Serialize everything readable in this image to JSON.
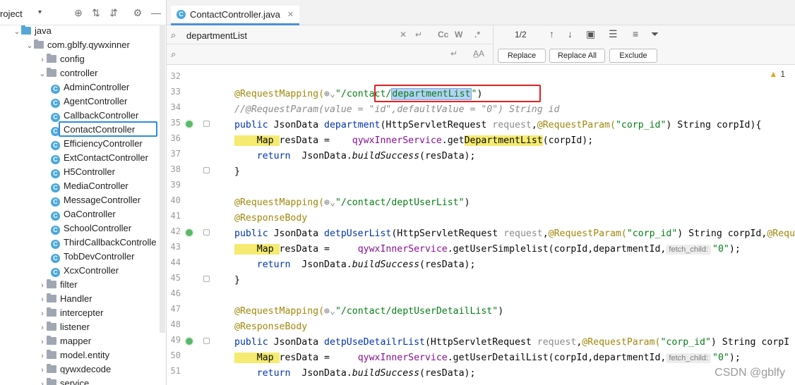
{
  "project_panel": {
    "title": "roject",
    "tree": [
      {
        "label": "java",
        "indent": 1,
        "type": "folder-blue",
        "expanded": true
      },
      {
        "label": "com.gblfy.qywxinner",
        "indent": 2,
        "type": "package",
        "expanded": true
      },
      {
        "label": "config",
        "indent": 3,
        "type": "package",
        "expanded": false
      },
      {
        "label": "controller",
        "indent": 3,
        "type": "package",
        "expanded": true
      },
      {
        "label": "AdminController",
        "indent": 4,
        "type": "class"
      },
      {
        "label": "AgentController",
        "indent": 4,
        "type": "class"
      },
      {
        "label": "CallbackController",
        "indent": 4,
        "type": "class"
      },
      {
        "label": "ContactController",
        "indent": 4,
        "type": "class",
        "selected": true
      },
      {
        "label": "EfficiencyController",
        "indent": 4,
        "type": "class"
      },
      {
        "label": "ExtContactController",
        "indent": 4,
        "type": "class"
      },
      {
        "label": "H5Controller",
        "indent": 4,
        "type": "class"
      },
      {
        "label": "MediaController",
        "indent": 4,
        "type": "class"
      },
      {
        "label": "MessageController",
        "indent": 4,
        "type": "class"
      },
      {
        "label": "OaController",
        "indent": 4,
        "type": "class"
      },
      {
        "label": "SchoolController",
        "indent": 4,
        "type": "class"
      },
      {
        "label": "ThirdCallbackControlle",
        "indent": 4,
        "type": "class"
      },
      {
        "label": "TobDevController",
        "indent": 4,
        "type": "class"
      },
      {
        "label": "XcxController",
        "indent": 4,
        "type": "class"
      },
      {
        "label": "filter",
        "indent": 3,
        "type": "package",
        "expanded": false
      },
      {
        "label": "Handler",
        "indent": 3,
        "type": "package",
        "expanded": false
      },
      {
        "label": "intercepter",
        "indent": 3,
        "type": "package",
        "expanded": false
      },
      {
        "label": "listener",
        "indent": 3,
        "type": "package",
        "expanded": false
      },
      {
        "label": "mapper",
        "indent": 3,
        "type": "package",
        "expanded": false
      },
      {
        "label": "model.entity",
        "indent": 3,
        "type": "package",
        "expanded": false
      },
      {
        "label": "qywxdecode",
        "indent": 3,
        "type": "package",
        "expanded": false
      },
      {
        "label": "service",
        "indent": 3,
        "type": "package",
        "expanded": false
      }
    ]
  },
  "editor": {
    "tab_label": "ContactController.java",
    "find": {
      "search_value": "departmentList",
      "replace_value": "",
      "match_count": "1/2",
      "opt_case": "Cc",
      "opt_words": "W",
      "opt_regex": ".*",
      "opt_preserve": "A̲A",
      "replace_label": "Replace",
      "replace_all_label": "Replace All",
      "exclude_label": "Exclude"
    },
    "warning_count": "1",
    "line_numbers": [
      "32",
      "33",
      "34",
      "35",
      "36",
      "37",
      "38",
      "39",
      "40",
      "41",
      "42",
      "43",
      "44",
      "45",
      "46",
      "47",
      "48",
      "49",
      "50",
      "51"
    ],
    "code": {
      "l33_ann": "@RequestMapping(",
      "l33_str_a": "\"/contact/",
      "l33_str_b": "departmentList",
      "l33_str_c": "\"",
      "l33_end": ")",
      "l34": "//@RequestParam(value = \"id\",defaultValue = \"0\") String id",
      "l35_a": "public ",
      "l35_b": "JsonData ",
      "l35_c": "department",
      "l35_d": "(HttpServletRequest ",
      "l35_e": "request",
      "l35_f": ",",
      "l35_g": "@RequestParam(",
      "l35_h": "\"corp_id\"",
      "l35_i": ") String corpId){",
      "l36_a": "    Map ",
      "l36_b": "resData =    ",
      "l36_c": "qywxInnerService",
      "l36_d": ".get",
      "l36_e": "DepartmentList",
      "l36_f": "(corpId);",
      "l37_a": "    return  ",
      "l37_b": "JsonData.",
      "l37_c": "buildSuccess",
      "l37_d": "(resData);",
      "l38": "}",
      "l40_ann": "@RequestMapping(",
      "l40_str": "\"/contact/deptUserList\"",
      "l40_end": ")",
      "l41": "@ResponseBody",
      "l42_a": "public ",
      "l42_b": "JsonData ",
      "l42_c": "detpUserList",
      "l42_d": "(HttpServletRequest ",
      "l42_e": "request",
      "l42_f": ",",
      "l42_g": "@RequestParam(",
      "l42_h": "\"corp_id\"",
      "l42_i": ") String corpId,",
      "l42_j": "@Requ",
      "l43_a": "    Map ",
      "l43_b": "resData =     ",
      "l43_c": "qywxInnerService",
      "l43_d": ".getUserSimplelist(corpId,departmentId,",
      "l43_hint": "fetch_child:",
      "l43_str": "\"0\"",
      "l43_end": ");",
      "l44_a": "    return  ",
      "l44_b": "JsonData.",
      "l44_c": "buildSuccess",
      "l44_d": "(resData);",
      "l45": "}",
      "l47_ann": "@RequestMapping(",
      "l47_str": "\"/contact/deptUserDetailList\"",
      "l47_end": ")",
      "l48": "@ResponseBody",
      "l49_a": "public ",
      "l49_b": "JsonData ",
      "l49_c": "detpUseDetailrList",
      "l49_d": "(HttpServletRequest ",
      "l49_e": "request",
      "l49_f": ",",
      "l49_g": "@RequestParam(",
      "l49_h": "\"corp_id\"",
      "l49_i": ") String corpI",
      "l50_a": "    Map ",
      "l50_b": "resData =     ",
      "l50_c": "qywxInnerService",
      "l50_d": ".getUserDetailList(corpId,departmentId,",
      "l50_hint": "fetch_child:",
      "l50_str": "\"0\"",
      "l50_end": ");",
      "l51_a": "    return  ",
      "l51_b": "JsonData.",
      "l51_c": "buildSuccess",
      "l51_d": "(resData);"
    }
  },
  "watermark": "CSDN @gblfy",
  "icons": [
    "locate-icon",
    "expand-all-icon",
    "collapse-all-icon",
    "gear-icon",
    "minimize-icon",
    "search-icon",
    "clear-icon",
    "filter-icon",
    "up-arrow-icon",
    "down-arrow-icon",
    "bean-gutter-icon",
    "warning-icon"
  ],
  "colors": {
    "keyword": "#0033b3",
    "annotation": "#9e880d",
    "string": "#067d17",
    "field": "#871094",
    "highlight": "#f4eb70",
    "selection": "#b5d1f5",
    "callout": "#e02020",
    "selected_tree_outline": "#2f8de0"
  }
}
